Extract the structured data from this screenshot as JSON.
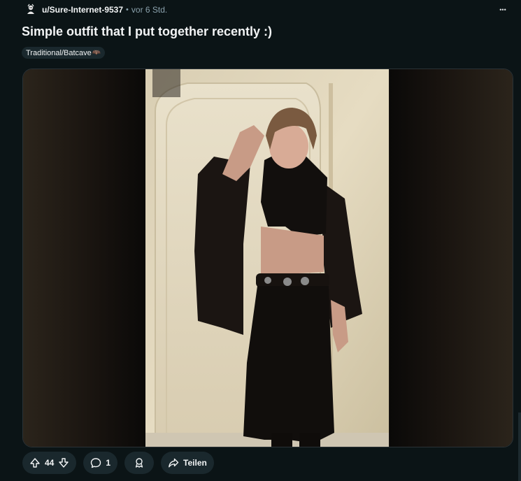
{
  "post": {
    "username": "u/Sure-Internet-9537",
    "separator": "•",
    "time": "vor 6 Std.",
    "more_label": "•••",
    "title": "Simple outfit that I put together recently :)",
    "flair": {
      "text": "Traditional/Batcave",
      "emoji": "🦇"
    }
  },
  "actions": {
    "vote_count": "44",
    "comment_count": "1",
    "share_label": "Teilen"
  },
  "colors": {
    "background": "#0b1416",
    "pill": "#1a282d",
    "text": "#f2f4f5",
    "muted": "#8ba2ad"
  },
  "icons": [
    "upvote-icon",
    "downvote-icon",
    "comment-icon",
    "award-icon",
    "share-icon",
    "more-icon"
  ]
}
